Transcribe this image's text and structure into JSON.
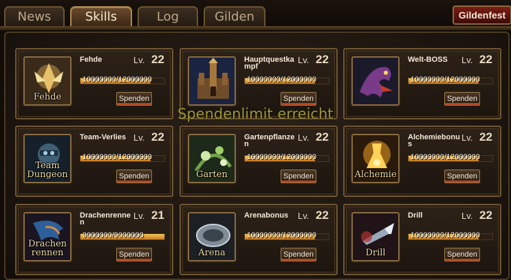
{
  "tabs": [
    {
      "label": "News",
      "active": false
    },
    {
      "label": "Skills",
      "active": true
    },
    {
      "label": "Log",
      "active": false
    },
    {
      "label": "Gilden",
      "active": false
    }
  ],
  "gildenfest_label": "Gildenfest",
  "notice": "Spendenlimit erreicht",
  "lv_prefix": "Lv.",
  "donate_label": "Spenden",
  "skills": [
    {
      "name": "Fehde",
      "icon_label": "Fehde",
      "level": "22",
      "progress": "10000000/12000000",
      "fill": 0.833,
      "icon": "knight-icon"
    },
    {
      "name": "Hauptquestkampf",
      "icon_label": "",
      "level": "22",
      "progress": "10000000/12000000",
      "fill": 0.833,
      "icon": "castle-icon"
    },
    {
      "name": "Welt-BOSS",
      "icon_label": "",
      "level": "22",
      "progress": "10000000/12000000",
      "fill": 0.833,
      "icon": "dragon-icon"
    },
    {
      "name": "Team-Verlies",
      "icon_label": "Team Dungeon",
      "level": "22",
      "progress": "10000000/12000000",
      "fill": 0.833,
      "icon": "dungeon-icon"
    },
    {
      "name": "Gartenpflanzen",
      "icon_label": "Garten",
      "level": "22",
      "progress": "10000000/12000000",
      "fill": 0.833,
      "icon": "garden-icon"
    },
    {
      "name": "Alchemiebonus",
      "icon_label": "Alchemie",
      "level": "22",
      "progress": "10000000/12000000",
      "fill": 0.833,
      "icon": "alchemy-icon"
    },
    {
      "name": "Drachenrennen",
      "icon_label": "Drachen rennen",
      "level": "21",
      "progress": "9000000/9000000",
      "fill": 1.0,
      "icon": "dragon-race-icon"
    },
    {
      "name": "Arenabonus",
      "icon_label": "Arena",
      "level": "22",
      "progress": "10000000/12000000",
      "fill": 0.833,
      "icon": "arena-icon"
    },
    {
      "name": "Drill",
      "icon_label": "Drill",
      "level": "22",
      "progress": "10000000/12000000",
      "fill": 0.833,
      "icon": "drill-icon"
    }
  ]
}
